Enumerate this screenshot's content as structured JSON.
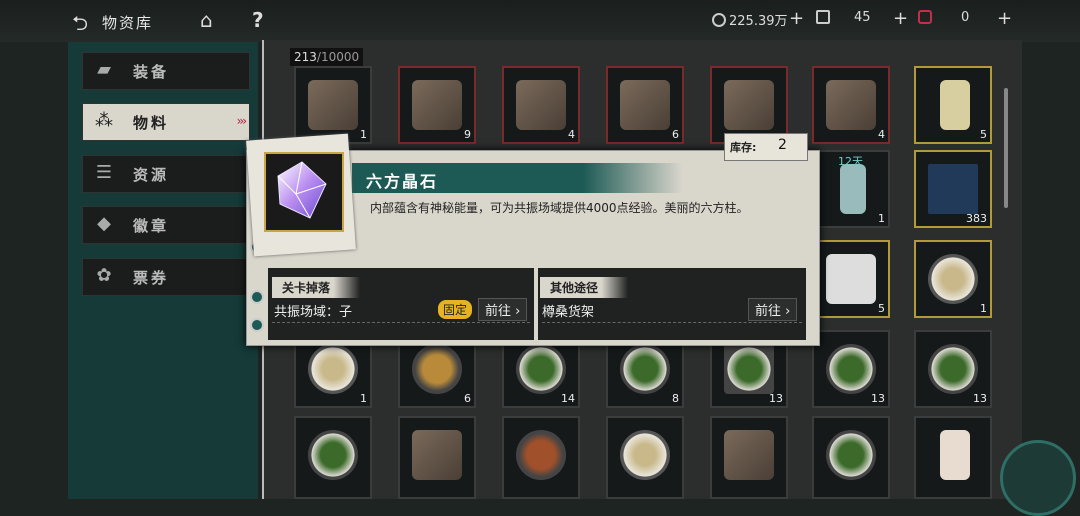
{
  "topbar": {
    "title": "物资库",
    "currency1": "225.39万",
    "currency2": "45",
    "currency3": "0"
  },
  "sidebar": {
    "items": [
      {
        "label": "装备"
      },
      {
        "label": "物料"
      },
      {
        "label": "资源"
      },
      {
        "label": "徽章"
      },
      {
        "label": "票券"
      }
    ]
  },
  "inventory": {
    "count": "213",
    "capacity": "/10000",
    "timer": "12天",
    "slot_counts": [
      "1",
      "9",
      "4",
      "6",
      "4",
      "5",
      "1",
      "383",
      "5",
      "1",
      "1",
      "6",
      "14",
      "8",
      "13",
      "13",
      "13"
    ]
  },
  "popup": {
    "title": "六方晶石",
    "description": "内部蕴含有神秘能量，可为共振场域提供4000点经验。美丽的六方柱。",
    "stock_label": "库存:",
    "stock_value": "2",
    "drop_heading": "关卡掉落",
    "drop_source": "共振场域：子",
    "fixed_badge": "固定",
    "go_label": "前往",
    "other_heading": "其他途径",
    "other_source": "樽桑货架",
    "go_label2": "前往"
  }
}
